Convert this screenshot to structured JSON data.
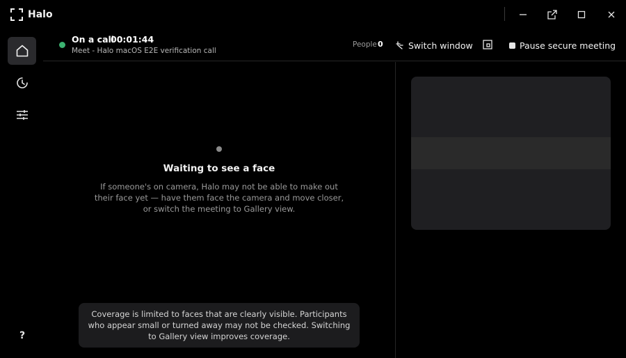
{
  "window": {
    "title": "Halo",
    "icons": {
      "logo": "scan-frame-icon",
      "minimize": "minimize-icon",
      "popout": "popout-icon",
      "maximize": "maximize-icon",
      "close": "close-icon"
    }
  },
  "sidebar": {
    "items": [
      {
        "name": "home",
        "icon": "home-icon",
        "active": true
      },
      {
        "name": "history",
        "icon": "clock-icon",
        "active": false
      },
      {
        "name": "settings",
        "icon": "sliders-icon",
        "active": false
      }
    ],
    "help_label": "?"
  },
  "call": {
    "status": "On a call",
    "timer": "00:01:44",
    "subtitle": "Meet - Halo macOS E2E verification call",
    "status_color": "#3cb371",
    "people_label": "People",
    "people_count": "0",
    "switch_label": "Switch window",
    "pause_label": "Pause secure meeting"
  },
  "main": {
    "waiting_title": "Waiting to see a face",
    "waiting_body": "If someone's on camera, Halo may not be able to make out their face yet — have them face the camera and move closer, or switch the meeting to Gallery view.",
    "coverage_note": "Coverage is limited to faces that are clearly visible. Participants who appear small or turned away may not be checked. Switching to Gallery view improves coverage."
  }
}
